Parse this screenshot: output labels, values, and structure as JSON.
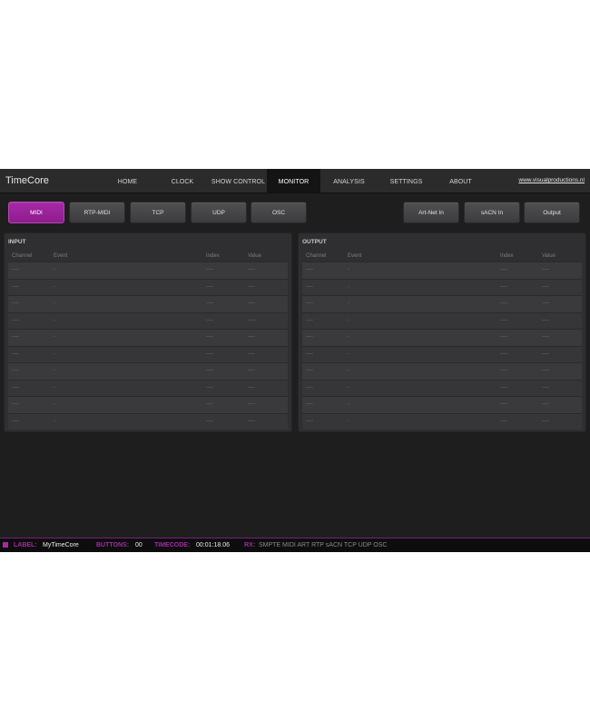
{
  "brand": "TimeCore",
  "nav": [
    {
      "label": "HOME"
    },
    {
      "label": "CLOCK"
    },
    {
      "label": "SHOW CONTROL"
    },
    {
      "label": "MONITOR",
      "active": true
    },
    {
      "label": "ANALYSIS"
    },
    {
      "label": "SETTINGS"
    },
    {
      "label": "ABOUT"
    }
  ],
  "site_link": "www.visualproductions.nl",
  "toolbar": {
    "left": [
      {
        "label": "MIDI",
        "active": true
      },
      {
        "label": "RTP-MIDI"
      },
      {
        "label": "TCP"
      },
      {
        "label": "UDP"
      },
      {
        "label": "OSC"
      }
    ],
    "right": [
      {
        "label": "Art-Net In"
      },
      {
        "label": "sACN In"
      },
      {
        "label": "Output"
      }
    ]
  },
  "input_panel": {
    "title": "INPUT",
    "columns": {
      "channel": "Channel",
      "event": "Event",
      "index": "Index",
      "value": "Value"
    },
    "rows": [
      {
        "channel": "----",
        "event": "-",
        "index": "----",
        "value": "----"
      },
      {
        "channel": "----",
        "event": "-",
        "index": "----",
        "value": "----"
      },
      {
        "channel": "----",
        "event": "-",
        "index": "----",
        "value": "----"
      },
      {
        "channel": "----",
        "event": "-",
        "index": "----",
        "value": "----"
      },
      {
        "channel": "----",
        "event": "-",
        "index": "----",
        "value": "----"
      },
      {
        "channel": "----",
        "event": "-",
        "index": "----",
        "value": "----"
      },
      {
        "channel": "----",
        "event": "-",
        "index": "----",
        "value": "----"
      },
      {
        "channel": "----",
        "event": "-",
        "index": "----",
        "value": "----"
      },
      {
        "channel": "----",
        "event": "-",
        "index": "----",
        "value": "----"
      },
      {
        "channel": "----",
        "event": "-",
        "index": "----",
        "value": "----"
      }
    ]
  },
  "output_panel": {
    "title": "OUTPUT",
    "columns": {
      "channel": "Channel",
      "event": "Event",
      "index": "Index",
      "value": "Value"
    },
    "rows": [
      {
        "channel": "----",
        "event": "-",
        "index": "----",
        "value": "----"
      },
      {
        "channel": "----",
        "event": "-",
        "index": "----",
        "value": "----"
      },
      {
        "channel": "----",
        "event": "-",
        "index": "----",
        "value": "----"
      },
      {
        "channel": "----",
        "event": "-",
        "index": "----",
        "value": "----"
      },
      {
        "channel": "----",
        "event": "-",
        "index": "----",
        "value": "----"
      },
      {
        "channel": "----",
        "event": "-",
        "index": "----",
        "value": "----"
      },
      {
        "channel": "----",
        "event": "-",
        "index": "----",
        "value": "----"
      },
      {
        "channel": "----",
        "event": "-",
        "index": "----",
        "value": "----"
      },
      {
        "channel": "----",
        "event": "-",
        "index": "----",
        "value": "----"
      },
      {
        "channel": "----",
        "event": "-",
        "index": "----",
        "value": "----"
      }
    ]
  },
  "status": {
    "label_key": "LABEL:",
    "label_value": "MyTimeCore",
    "buttons_key": "BUTTONS:",
    "buttons_value": "00",
    "timecode_key": "TIMECODE:",
    "timecode_value": "00:01:18.06",
    "rx_key": "RX:",
    "rx_items": "SMPTE MIDI ART RTP sACN TCP UDP OSC"
  },
  "colors": {
    "accent": "#a32ba3",
    "background": "#1e1e1f",
    "panel": "#2f2f31"
  }
}
